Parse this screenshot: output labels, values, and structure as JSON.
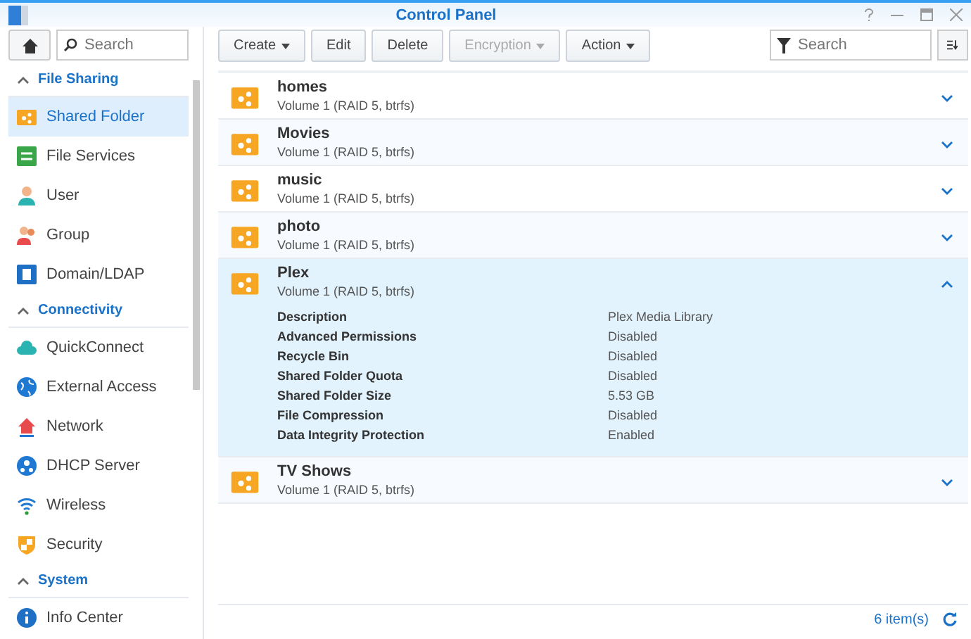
{
  "window": {
    "title": "Control Panel"
  },
  "sidebar": {
    "search": {
      "placeholder": "Search"
    },
    "sections": [
      {
        "title": "File Sharing",
        "expanded": true,
        "items": [
          {
            "label": "Shared Folder",
            "selected": true
          },
          {
            "label": "File Services",
            "selected": false
          },
          {
            "label": "User",
            "selected": false
          },
          {
            "label": "Group",
            "selected": false
          },
          {
            "label": "Domain/LDAP",
            "selected": false
          }
        ]
      },
      {
        "title": "Connectivity",
        "expanded": true,
        "items": [
          {
            "label": "QuickConnect",
            "selected": false
          },
          {
            "label": "External Access",
            "selected": false
          },
          {
            "label": "Network",
            "selected": false
          },
          {
            "label": "DHCP Server",
            "selected": false
          },
          {
            "label": "Wireless",
            "selected": false
          },
          {
            "label": "Security",
            "selected": false
          }
        ]
      },
      {
        "title": "System",
        "expanded": true,
        "items": [
          {
            "label": "Info Center",
            "selected": false
          }
        ]
      }
    ]
  },
  "toolbar": {
    "buttons": [
      {
        "label": "Create",
        "dropdown": true,
        "disabled": false
      },
      {
        "label": "Edit",
        "dropdown": false,
        "disabled": false
      },
      {
        "label": "Delete",
        "dropdown": false,
        "disabled": false
      },
      {
        "label": "Encryption",
        "dropdown": true,
        "disabled": true
      },
      {
        "label": "Action",
        "dropdown": true,
        "disabled": false
      }
    ],
    "filter": {
      "placeholder": "Search"
    }
  },
  "folders": [
    {
      "name": "homes",
      "location": "Volume 1 (RAID 5, btrfs)",
      "expanded": false
    },
    {
      "name": "Movies",
      "location": "Volume 1 (RAID 5, btrfs)",
      "expanded": false
    },
    {
      "name": "music",
      "location": "Volume 1 (RAID 5, btrfs)",
      "expanded": false
    },
    {
      "name": "photo",
      "location": "Volume 1 (RAID 5, btrfs)",
      "expanded": false
    },
    {
      "name": "Plex",
      "location": "Volume 1 (RAID 5, btrfs)",
      "expanded": true,
      "details": [
        {
          "label": "Description",
          "value": "Plex Media Library"
        },
        {
          "label": "Advanced Permissions",
          "value": "Disabled"
        },
        {
          "label": "Recycle Bin",
          "value": "Disabled"
        },
        {
          "label": "Shared Folder Quota",
          "value": "Disabled"
        },
        {
          "label": "Shared Folder Size",
          "value": "5.53 GB"
        },
        {
          "label": "File Compression",
          "value": "Disabled"
        },
        {
          "label": "Data Integrity Protection",
          "value": "Enabled"
        }
      ]
    },
    {
      "name": "TV Shows",
      "location": "Volume 1 (RAID 5, btrfs)",
      "expanded": false
    }
  ],
  "status_bar": {
    "count": "6 item(s)"
  }
}
